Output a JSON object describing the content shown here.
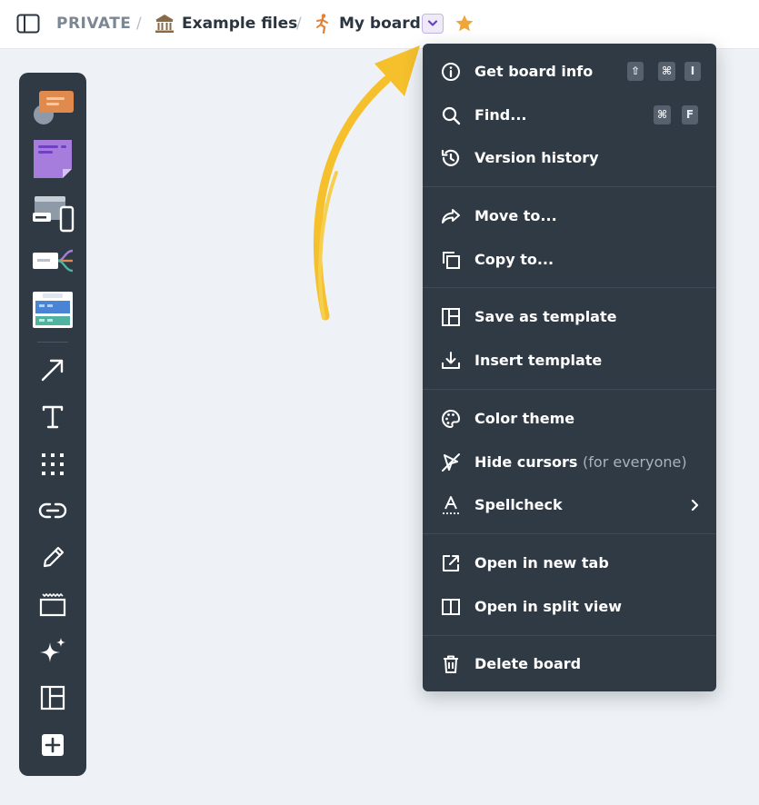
{
  "breadcrumb": {
    "workspace": "PRIVATE",
    "separator": "/",
    "folder": "Example files",
    "board": "My board"
  },
  "icons": {
    "sidebar_toggle": "sidebar-panel-icon",
    "folder": "bank-building-icon",
    "board": "running-figure-icon",
    "dropdown": "chevron-down-icon",
    "favorite": "star-icon"
  },
  "colors": {
    "canvas": "#eef2f6",
    "panel": "#2f3a45",
    "accent_purple": "#7b4fcf",
    "star": "#f0a53a",
    "arrow": "#f5c02c"
  },
  "toolbar": {
    "tools": [
      "comment-cards-icon",
      "sticky-note-icon",
      "device-mockup-icon",
      "mind-map-icon",
      "kanban-template-icon",
      "arrow-line-icon",
      "text-icon",
      "grid-icon",
      "link-icon",
      "pencil-icon",
      "frame-icon",
      "ai-sparkle-icon",
      "layout-template-icon",
      "add-more-icon"
    ]
  },
  "menu": {
    "get_info": {
      "label": "Get board info",
      "keys": [
        "⇧",
        "⌘",
        "I"
      ]
    },
    "find": {
      "label": "Find...",
      "keys": [
        "⌘",
        "F"
      ]
    },
    "version_history": {
      "label": "Version history"
    },
    "move_to": {
      "label": "Move to..."
    },
    "copy_to": {
      "label": "Copy to..."
    },
    "save_template": {
      "label": "Save as template"
    },
    "insert_template": {
      "label": "Insert template"
    },
    "color_theme": {
      "label": "Color theme"
    },
    "hide_cursors": {
      "label": "Hide cursors",
      "suffix": "(for everyone)"
    },
    "spellcheck": {
      "label": "Spellcheck"
    },
    "open_new_tab": {
      "label": "Open in new tab"
    },
    "open_split": {
      "label": "Open in split view"
    },
    "delete_board": {
      "label": "Delete board"
    }
  }
}
